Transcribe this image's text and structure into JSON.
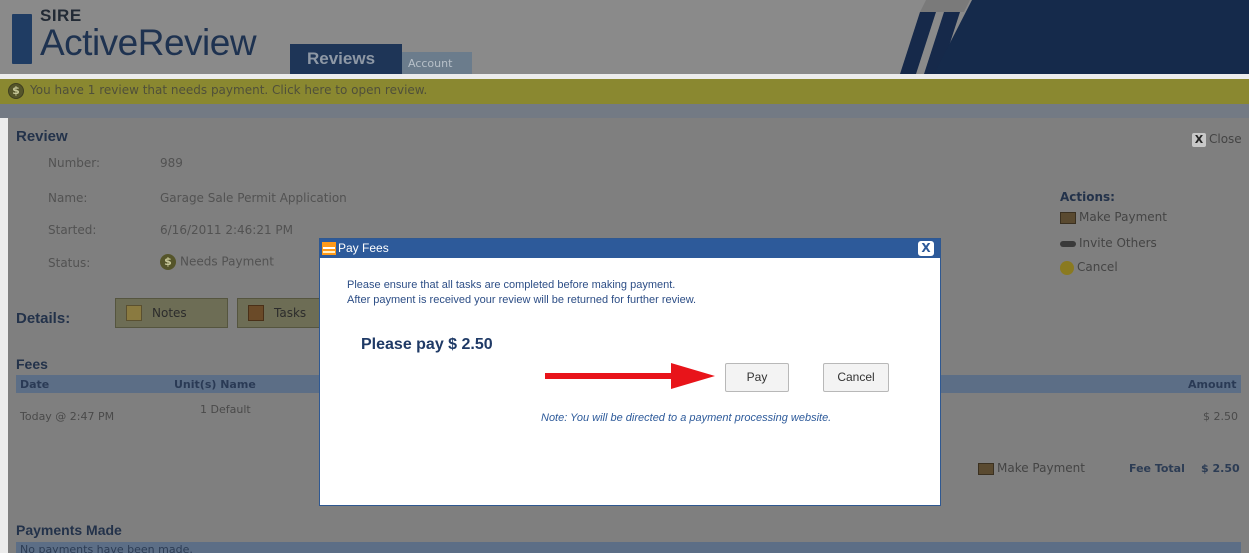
{
  "app": {
    "logo_small": "SIRE",
    "logo_big": "ActiveReview",
    "tabs": [
      {
        "label": "Reviews",
        "active": true
      },
      {
        "label": "Account",
        "active": false
      }
    ]
  },
  "notification": {
    "text": "You have 1 review that needs payment. Click here to open review.",
    "icon": "dollar-icon"
  },
  "review": {
    "title": "Review",
    "close_label": "Close",
    "fields": [
      {
        "label": "Number:",
        "value": "989"
      },
      {
        "label": "Name:",
        "value": "Garage Sale Permit Application"
      },
      {
        "label": "Started:",
        "value": "6/16/2011 2:46:21 PM"
      },
      {
        "label": "Status:",
        "value": "Needs Payment"
      }
    ],
    "actions_title": "Actions:",
    "actions": [
      {
        "label": "Make Payment",
        "icon": "payment-icon"
      },
      {
        "label": "Invite Others",
        "icon": "invite-icon"
      },
      {
        "label": "Cancel",
        "icon": "cancel-icon"
      }
    ],
    "details_label": "Details:",
    "detail_buttons": [
      {
        "label": "Notes",
        "icon": "notes-icon"
      },
      {
        "label": "Tasks",
        "icon": "tasks-icon"
      }
    ]
  },
  "fees": {
    "title": "Fees",
    "columns": [
      "Date",
      "Unit(s) Name",
      "Amount"
    ],
    "rows": [
      {
        "date": "Today @ 2:47 PM",
        "units_name": "1 Default",
        "amount": "$ 2.50"
      }
    ],
    "make_payment_label": "Make Payment",
    "fee_total_label": "Fee Total",
    "fee_total_value": "$ 2.50"
  },
  "payments": {
    "title": "Payments Made",
    "empty_text": "No payments have been made."
  },
  "modal": {
    "title": "Pay Fees",
    "message_line1": "Please ensure that all tasks are completed before making payment.",
    "message_line2": "After payment is received your review will be returned for further review.",
    "please_pay": "Please pay $ 2.50",
    "pay_button": "Pay",
    "cancel_button": "Cancel",
    "note": "Note: You will be directed to a payment processing website."
  },
  "colors": {
    "brand_navy": "#1e3557",
    "dialog_blue": "#2d5a9a",
    "arrow_red": "#e8141a"
  }
}
